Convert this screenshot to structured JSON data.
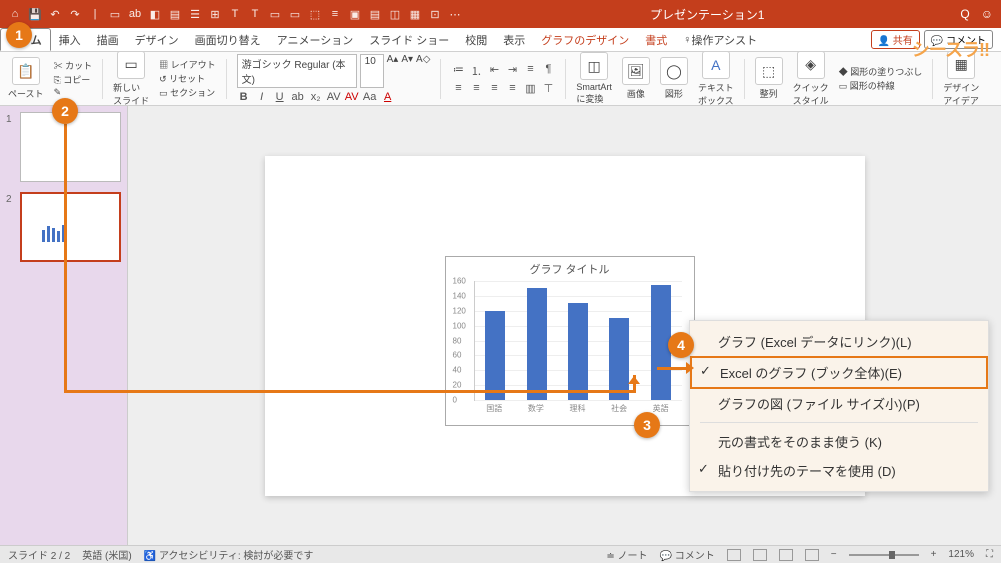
{
  "app_title": "プレゼンテーション1",
  "logo": "シースラ!!",
  "tabs": {
    "home": "ホーム",
    "insert": "挿入",
    "draw": "描画",
    "design": "デザイン",
    "transitions": "画面切り替え",
    "animations": "アニメーション",
    "slideshow": "スライド ショー",
    "review": "校閲",
    "view": "表示",
    "chart_design": "グラフのデザイン",
    "format": "書式",
    "tell_me": "操作アシスト",
    "share": "共有",
    "comment": "コメント"
  },
  "ribbon": {
    "paste": "ペースト",
    "cut": "カット",
    "copy": "コピー",
    "new_slide": "新しい\nスライド",
    "layout": "レイアウト",
    "reset": "リセット",
    "section": "セクション",
    "font_name": "游ゴシック Regular (本文)",
    "font_size": "10",
    "smartart": "SmartArt\nに変換",
    "picture": "画像",
    "shapes": "図形",
    "textbox": "テキスト\nボックス",
    "arrange": "整列",
    "quick_style": "クイック\nスタイル",
    "shape_fill": "図形の塗りつぶし",
    "shape_outline": "図形の枠線",
    "design_ideas": "デザイン\nアイデア"
  },
  "chart_data": {
    "type": "bar",
    "title": "グラフ タイトル",
    "categories": [
      "国語",
      "数学",
      "理科",
      "社会",
      "英語"
    ],
    "values": [
      120,
      150,
      130,
      110,
      155
    ],
    "ylim": [
      0,
      160
    ],
    "yticks": [
      0,
      20,
      40,
      60,
      80,
      100,
      120,
      140,
      160
    ],
    "xlabel": "",
    "ylabel": ""
  },
  "paste_options": {
    "opt1": "グラフ (Excel データにリンク)(L)",
    "opt2": "Excel のグラフ (ブック全体)(E)",
    "opt3": "グラフの図 (ファイル サイズ小)(P)",
    "opt4": "元の書式をそのまま使う (K)",
    "opt5": "貼り付け先のテーマを使用 (D)"
  },
  "status": {
    "slide_count": "スライド 2 / 2",
    "language": "英語 (米国)",
    "accessibility": "アクセシビリティ: 検討が必要です",
    "notes": "ノート",
    "comments": "コメント",
    "zoom": "121%"
  },
  "thumbs": {
    "n1": "1",
    "n2": "2"
  },
  "badges": {
    "b1": "1",
    "b2": "2",
    "b3": "3",
    "b4": "4"
  }
}
